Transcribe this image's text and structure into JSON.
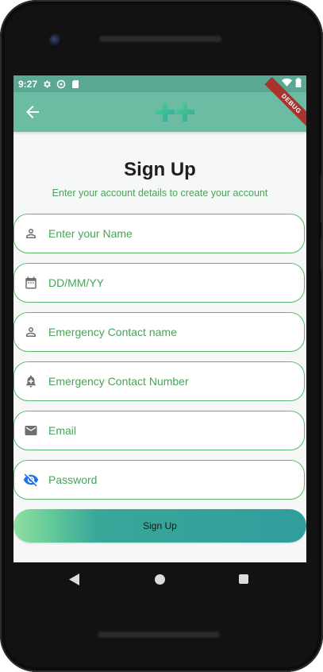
{
  "status": {
    "time": "9:27",
    "icons": [
      "settings-icon",
      "do-not-disturb-icon",
      "sd-card-icon",
      "wifi-icon",
      "battery-icon"
    ]
  },
  "appbar": {
    "back_icon": "arrow-left-icon",
    "logo_icon": "medical-cross-logo",
    "debug_label": "DEBUG"
  },
  "page": {
    "title": "Sign Up",
    "subtitle": "Enter your account details to create your account"
  },
  "form": {
    "fields": [
      {
        "placeholder": "Enter your Name",
        "icon": "person-icon"
      },
      {
        "placeholder": "DD/MM/YY",
        "icon": "calendar-icon"
      },
      {
        "placeholder": "Emergency Contact name",
        "icon": "person-icon"
      },
      {
        "placeholder": "Emergency Contact Number",
        "icon": "notification-add-icon"
      },
      {
        "placeholder": "Email",
        "icon": "email-icon"
      },
      {
        "placeholder": "Password",
        "icon": "visibility-off-icon"
      }
    ],
    "submit_label": "Sign Up"
  },
  "colors": {
    "appbar": "#6bbca3",
    "accent_green": "#4aa35a",
    "field_border": "#5cb86a",
    "visibility_icon": "#1a73e8"
  }
}
